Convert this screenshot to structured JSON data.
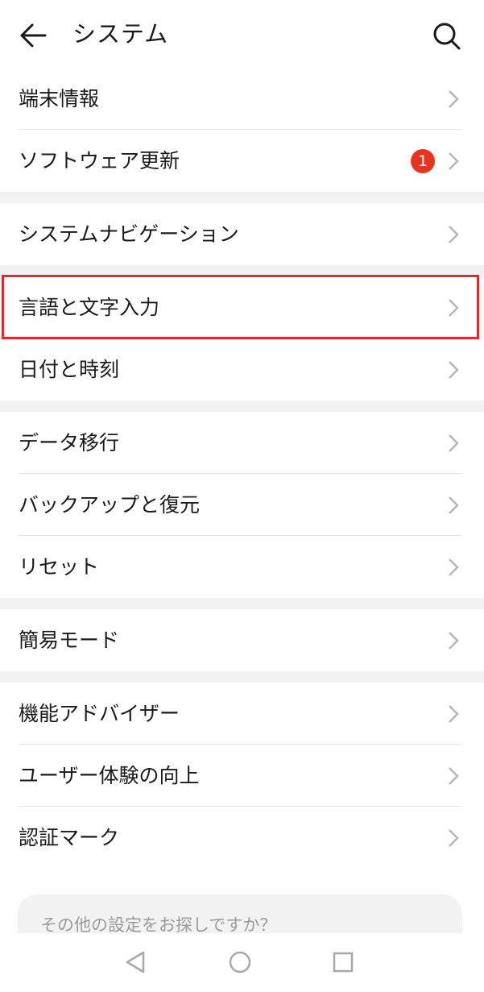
{
  "header": {
    "title": "システム",
    "back_icon": "arrow-left-icon",
    "search_icon": "search-icon"
  },
  "sections": [
    {
      "items": [
        {
          "label": "端末情報"
        },
        {
          "label": "ソフトウェア更新",
          "badge": "1"
        }
      ]
    },
    {
      "items": [
        {
          "label": "システムナビゲーション"
        },
        {
          "label": "言語と文字入力",
          "highlighted": true
        },
        {
          "label": "日付と時刻"
        }
      ]
    },
    {
      "items": [
        {
          "label": "データ移行"
        },
        {
          "label": "バックアップと復元"
        },
        {
          "label": "リセット"
        }
      ]
    },
    {
      "items": [
        {
          "label": "簡易モード"
        }
      ]
    },
    {
      "items": [
        {
          "label": "機能アドバイザー"
        },
        {
          "label": "ユーザー体験の向上"
        },
        {
          "label": "認証マーク"
        }
      ]
    }
  ],
  "suggestion": {
    "text": "その他の設定をお探しですか？"
  },
  "navbar": {
    "back": "triangle-back-icon",
    "home": "circle-home-icon",
    "recents": "square-recents-icon"
  },
  "colors": {
    "badge": "#e8341f",
    "highlight": "#e3282e",
    "section_gap": "#f2f2f2"
  }
}
